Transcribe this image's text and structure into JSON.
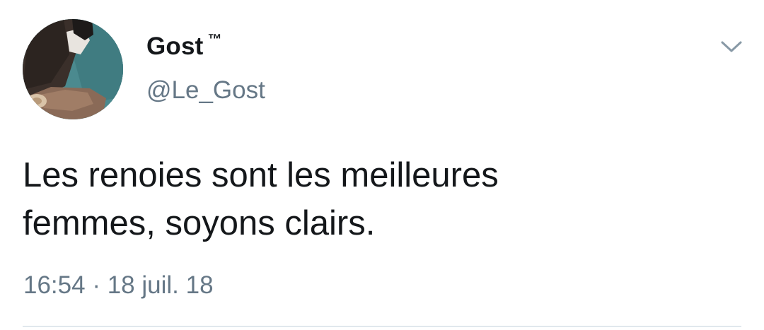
{
  "tweet": {
    "author": {
      "display_name": "Gost",
      "badge": "™",
      "handle": "@Le_Gost",
      "avatar": "profile-photo"
    },
    "text_line_1": "Les renoies sont les meilleures",
    "text_line_2": "femmes, soyons clairs.",
    "time": "16:54",
    "separator": "·",
    "date": "18 juil. 18",
    "menu_icon": "chevron-down-icon"
  },
  "colors": {
    "primary_text": "#14171a",
    "secondary_text": "#657786",
    "divider": "#e1e8ed",
    "background": "#ffffff"
  }
}
